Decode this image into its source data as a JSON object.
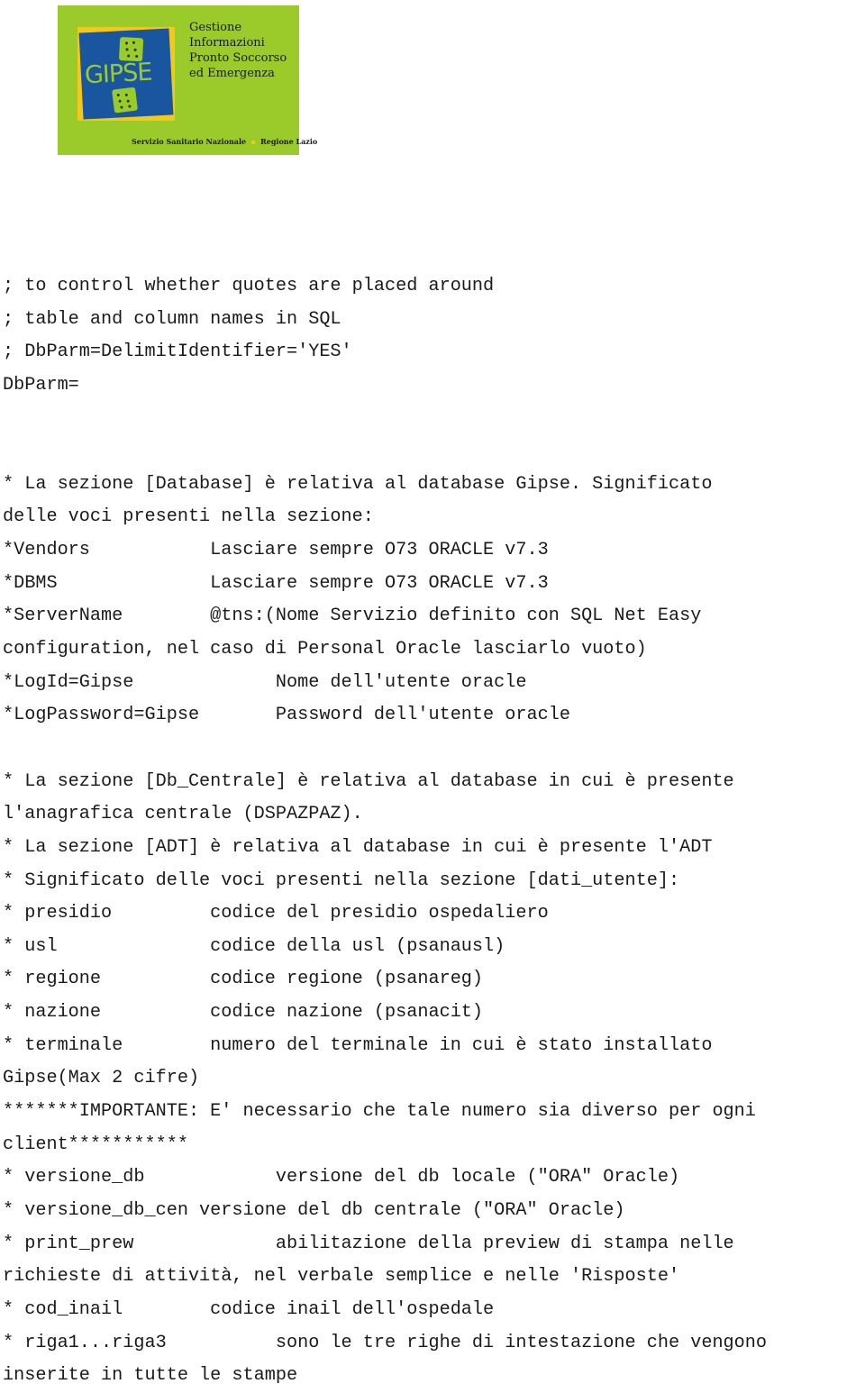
{
  "logo": {
    "wordmark": "GIPSE",
    "title_lines": [
      "Gestione",
      "Informazioni",
      "Pronto Soccorso",
      "ed Emergenza"
    ],
    "footer_left": "Servizio Sanitario Nazionale",
    "footer_right": "Regione Lazio",
    "colors": {
      "background": "#9bcb2a",
      "frame": "#f3c81b",
      "mark": "#1a56a0"
    }
  },
  "document": {
    "lines": [
      "; to control whether quotes are placed around",
      "; table and column names in SQL",
      "; DbParm=DelimitIdentifier='YES'",
      "DbParm=",
      "",
      "",
      "* La sezione [Database] è relativa al database Gipse. Significato",
      "delle voci presenti nella sezione:",
      "*Vendors           Lasciare sempre O73 ORACLE v7.3",
      "*DBMS              Lasciare sempre O73 ORACLE v7.3",
      "*ServerName        @tns:(Nome Servizio definito con SQL Net Easy",
      "configuration, nel caso di Personal Oracle lasciarlo vuoto)",
      "*LogId=Gipse             Nome dell'utente oracle",
      "*LogPassword=Gipse       Password dell'utente oracle",
      "",
      "* La sezione [Db_Centrale] è relativa al database in cui è presente",
      "l'anagrafica centrale (DSPAZPAZ).",
      "* La sezione [ADT] è relativa al database in cui è presente l'ADT",
      "* Significato delle voci presenti nella sezione [dati_utente]:",
      "* presidio         codice del presidio ospedaliero",
      "* usl              codice della usl (psanausl)",
      "* regione          codice regione (psanareg)",
      "* nazione          codice nazione (psanacit)",
      "* terminale        numero del terminale in cui è stato installato",
      "Gipse(Max 2 cifre)",
      "*******IMPORTANTE: E' necessario che tale numero sia diverso per ogni",
      "client***********",
      "* versione_db            versione del db locale (\"ORA\" Oracle)",
      "* versione_db_cen versione del db centrale (\"ORA\" Oracle)",
      "* print_prew             abilitazione della preview di stampa nelle",
      "richieste di attività, nel verbale semplice e nelle 'Risposte'",
      "* cod_inail        codice inail dell'ospedale",
      "* riga1...riga3          sono le tre righe di intestazione che vengono",
      "inserite in tutte le stampe"
    ]
  }
}
